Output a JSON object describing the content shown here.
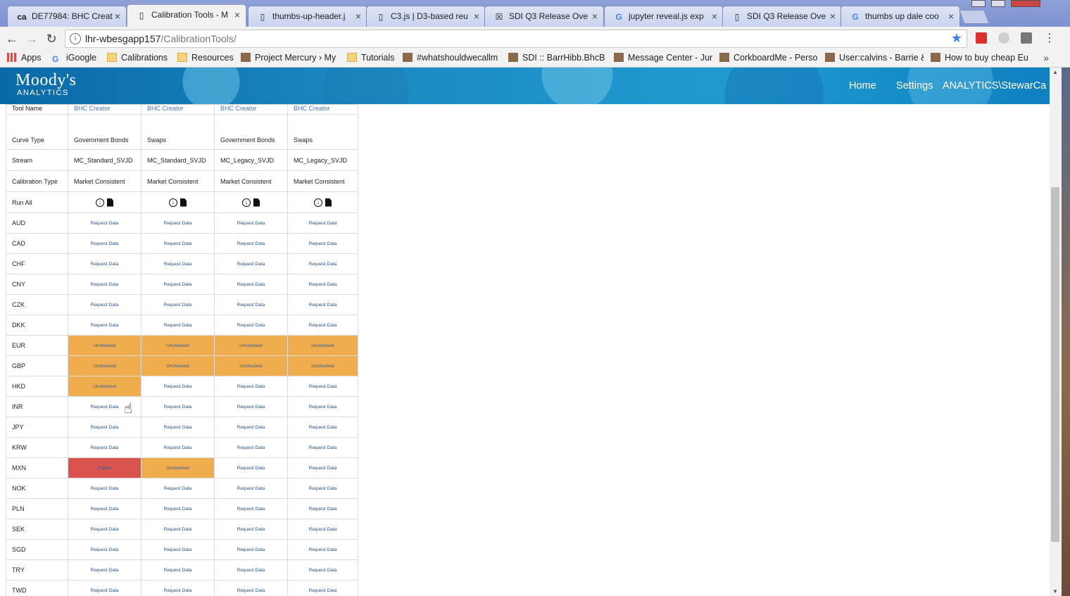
{
  "tabs": [
    {
      "icon": "ca",
      "title": "DE77984: BHC Creat"
    },
    {
      "icon": "doc",
      "title": "Calibration Tools - M",
      "active": true
    },
    {
      "icon": "doc",
      "title": "thumbs-up-header.j"
    },
    {
      "icon": "doc",
      "title": "C3.js | D3-based reu"
    },
    {
      "icon": "x",
      "title": "SDI Q3 Release Ove"
    },
    {
      "icon": "G",
      "title": "jupyter reveal.js exp"
    },
    {
      "icon": "doc",
      "title": "SDI Q3 Release Ove"
    },
    {
      "icon": "G",
      "title": "thumbs up dale coo"
    }
  ],
  "toolbar": {
    "url_host": "lhr-wbesgapp157",
    "url_path": "/CalibrationTools/"
  },
  "bookmarks": [
    {
      "label": "Apps"
    },
    {
      "label": "iGoogle"
    },
    {
      "label": "Calibrations"
    },
    {
      "label": "Resources"
    },
    {
      "label": "Project Mercury › My"
    },
    {
      "label": "Tutorials"
    },
    {
      "label": "#whatshouldwecallm"
    },
    {
      "label": "SDI :: BarrHibb.BhcBu"
    },
    {
      "label": "Message Center - Jur"
    },
    {
      "label": "CorkboardMe - Perso"
    },
    {
      "label": "User:calvins - Barrie &"
    },
    {
      "label": "How to buy cheap Eu"
    }
  ],
  "app": {
    "logo_line1": "Moody's",
    "logo_line2": "ANALYTICS",
    "nav": [
      "Home",
      "Settings",
      "ANALYTICS\\StewarCa"
    ]
  },
  "table": {
    "headers": {
      "tool_name": "Tool Name",
      "curve_type": "Curve Type",
      "stream": "Stream",
      "calibration_type": "Calibration Type",
      "run_all": "Run All"
    },
    "columns": [
      {
        "tool": "BHC Creator",
        "curve": "Government Bonds",
        "stream": "MC_Standard_SVJD",
        "calib": "Market Consistent"
      },
      {
        "tool": "BHC Creator",
        "curve": "Swaps",
        "stream": "MC_Standard_SVJD",
        "calib": "Market Consistent"
      },
      {
        "tool": "BHC Creator",
        "curve": "Government Bonds",
        "stream": "MC_Legacy_SVJD",
        "calib": "Market Consistent"
      },
      {
        "tool": "BHC Creator",
        "curve": "Swaps",
        "stream": "MC_Legacy_SVJD",
        "calib": "Market Consistent"
      }
    ],
    "rows": [
      {
        "ccy": "AUD",
        "cells": [
          "Request Data",
          "Request Data",
          "Request Data",
          "Request Data"
        ]
      },
      {
        "ccy": "CAD",
        "cells": [
          "Request Data",
          "Request Data",
          "Request Data",
          "Request Data"
        ]
      },
      {
        "ccy": "CHF",
        "cells": [
          "Request Data",
          "Request Data",
          "Request Data",
          "Request Data"
        ]
      },
      {
        "ccy": "CNY",
        "cells": [
          "Request Data",
          "Request Data",
          "Request Data",
          "Request Data"
        ]
      },
      {
        "ccy": "CZK",
        "cells": [
          "Request Data",
          "Request Data",
          "Request Data",
          "Request Data"
        ]
      },
      {
        "ccy": "DKK",
        "cells": [
          "Request Data",
          "Request Data",
          "Request Data",
          "Request Data"
        ]
      },
      {
        "ccy": "EUR",
        "cells": [
          "Unchecked",
          "Unchecked",
          "Unchecked",
          "Unchecked"
        ]
      },
      {
        "ccy": "GBP",
        "cells": [
          "Unchecked",
          "Unchecked",
          "Unchecked",
          "Unchecked"
        ]
      },
      {
        "ccy": "HKD",
        "cells": [
          "Unchecked",
          "Request Data",
          "Request Data",
          "Request Data"
        ]
      },
      {
        "ccy": "INR",
        "cells": [
          "Request Data",
          "Request Data",
          "Request Data",
          "Request Data"
        ]
      },
      {
        "ccy": "JPY",
        "cells": [
          "Request Data",
          "Request Data",
          "Request Data",
          "Request Data"
        ]
      },
      {
        "ccy": "KRW",
        "cells": [
          "Request Data",
          "Request Data",
          "Request Data",
          "Request Data"
        ]
      },
      {
        "ccy": "MXN",
        "cells": [
          "Failed",
          "Unchecked",
          "Request Data",
          "Request Data"
        ]
      },
      {
        "ccy": "NOK",
        "cells": [
          "Request Data",
          "Request Data",
          "Request Data",
          "Request Data"
        ]
      },
      {
        "ccy": "PLN",
        "cells": [
          "Request Data",
          "Request Data",
          "Request Data",
          "Request Data"
        ]
      },
      {
        "ccy": "SEK",
        "cells": [
          "Request Data",
          "Request Data",
          "Request Data",
          "Request Data"
        ]
      },
      {
        "ccy": "SGD",
        "cells": [
          "Request Data",
          "Request Data",
          "Request Data",
          "Request Data"
        ]
      },
      {
        "ccy": "TRY",
        "cells": [
          "Request Data",
          "Request Data",
          "Request Data",
          "Request Data"
        ]
      },
      {
        "ccy": "TWD",
        "cells": [
          "Request Data",
          "Request Data",
          "Request Data",
          "Request Data"
        ]
      }
    ]
  },
  "colors": {
    "unchecked": "#f0ad4e",
    "failed": "#d9534f",
    "link": "#1d4f8e"
  }
}
